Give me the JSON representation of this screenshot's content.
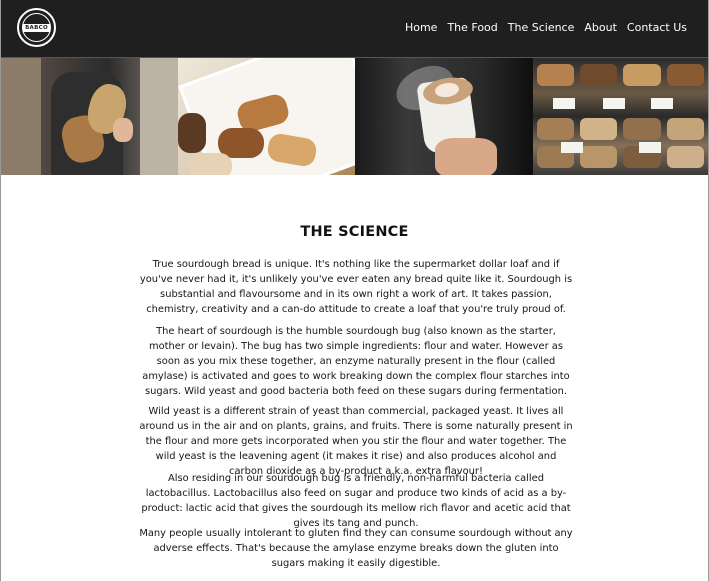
{
  "header": {
    "logo_text": "BABCO",
    "nav": [
      {
        "label": "Home"
      },
      {
        "label": "The Food"
      },
      {
        "label": "The Science"
      },
      {
        "label": "About"
      },
      {
        "label": "Contact Us"
      }
    ]
  },
  "gallery": [
    {
      "subject": "baker holding sourdough loaves"
    },
    {
      "subject": "box of pastries"
    },
    {
      "subject": "latte art coffee cup"
    },
    {
      "subject": "bakery display case"
    }
  ],
  "main": {
    "title": "THE SCIENCE",
    "paragraphs": [
      "True sourdough bread is unique. It's nothing like the supermarket dollar loaf and if you've never had it, it's unlikely you've ever eaten any bread quite like it. Sourdough is substantial and flavoursome and in its own right a work of art. It takes passion, chemistry, creativity and a can-do attitude to create a loaf that you're truly proud of.",
      "The heart of sourdough is the humble sourdough bug (also known as the starter, mother or levain). The bug has two simple ingredients: flour and water. However as soon as you mix these together, an enzyme naturally present in the flour (called amylase) is activated and goes to work breaking down the complex flour starches into sugars. Wild yeast and good bacteria both feed on these sugars during fermentation.",
      "Wild yeast is a different strain of yeast than commercial, packaged yeast. It lives all around us in the air and on plants, grains, and fruits. There is some naturally present in the flour and more gets incorporated when you stir the flour and water together. The wild yeast is the leavening agent (it makes it rise) and also produces alcohol and carbon dioxide as a by-product a.k.a. extra flavour!",
      "Also residing in our sourdough bug is a friendly, non-harmful bacteria called lactobacillus. Lactobacillus also feed on sugar and produce two kinds of acid as a by-product: lactic acid that gives the sourdough its mellow rich flavor and acetic acid that gives its tang and punch.",
      "Many people usually intolerant to gluten find they can consume sourdough without any adverse effects. That's because the amylase enzyme breaks down the gluten into sugars making it easily digestible."
    ]
  },
  "colors": {
    "header_bg": "#1f1f1f",
    "nav_text": "#ffffff",
    "body_bg": "#ffffff",
    "text": "#161616"
  }
}
